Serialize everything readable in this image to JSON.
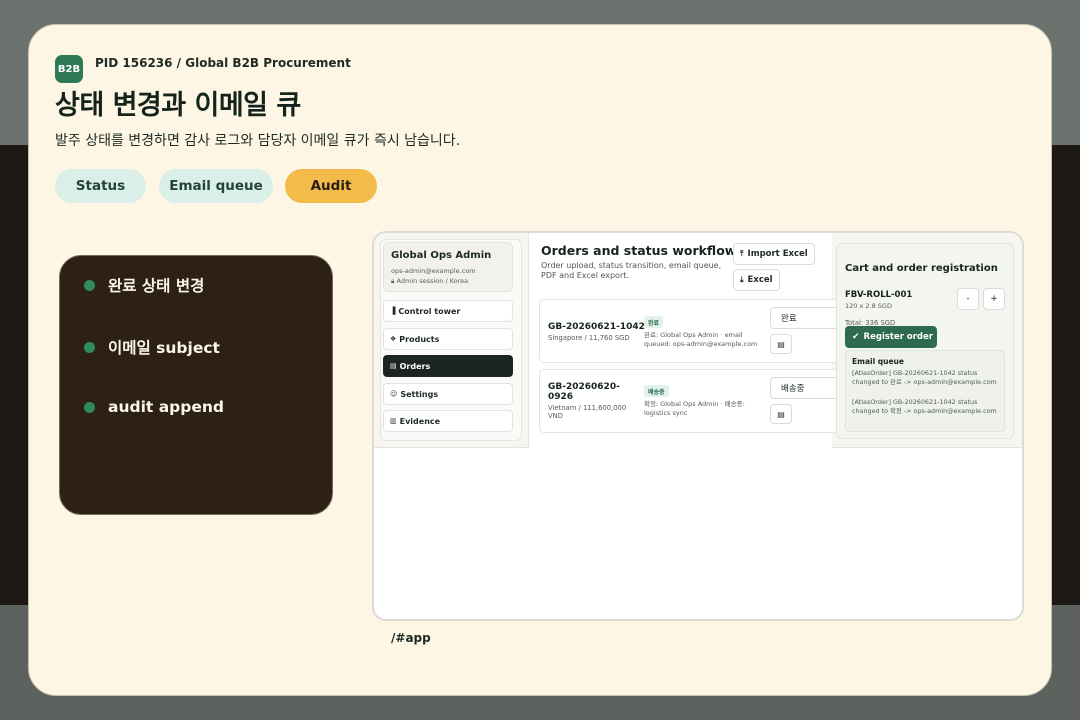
{
  "header": {
    "badge": "B2B",
    "pid": "PID 156236 / Global B2B Procurement",
    "title": "상태 변경과 이메일 큐",
    "subtitle": "발주 상태를 변경하면 감사 로그와 담당자 이메일 큐가 즉시 남습니다."
  },
  "pills": {
    "status": "Status",
    "email_queue": "Email queue",
    "audit": "Audit"
  },
  "steps": [
    "완료 상태 변경",
    "이메일 subject",
    "audit append"
  ],
  "app": {
    "admin": {
      "name": "Global Ops Admin",
      "email": "ops-admin@example.com",
      "session": "Admin session / Korea"
    },
    "nav": [
      "Control tower",
      "Products",
      "Orders",
      "Settings",
      "Evidence"
    ],
    "main": {
      "title": "Orders and status workflow",
      "description": "Order upload, status transition, email queue, PDF and Excel export.",
      "import_label": "Import Excel",
      "excel_label": "Excel"
    },
    "orders": [
      {
        "id": "GB-20260621-1042",
        "meta": "Singapore / 11,760 SGD",
        "badge": "완료",
        "note": "완료: Global Ops Admin · email queued: ops-admin@example.com",
        "status": "완료"
      },
      {
        "id": "GB-20260620-0926",
        "meta": "Vietnam / 111,600,000 VND",
        "badge": "배송중",
        "note": "확정: Global Ops Admin · 배송중: logistics sync",
        "status": "배송중"
      }
    ],
    "cart": {
      "title": "Cart and order registration",
      "sku": "FBV-ROLL-001",
      "sku_meta": "120 x 2.8 SGD",
      "minus": "-",
      "plus": "+",
      "total": "Total: 336 SGD",
      "register_label": "Register order",
      "email_queue_title": "Email queue",
      "email_queue": [
        "[AtlasOrder] GB-20260621-1042 status changed to 완료 -> ops-admin@example.com",
        "[AtlasOrder] GB-20260621-1042 status changed to 확정 -> ops-admin@example.com"
      ]
    }
  },
  "footer": {
    "path": "/#app"
  },
  "colors": {
    "accent_green": "#2e7a57",
    "audit_yellow": "#f2bb4a",
    "pill_mint": "#d9efe7",
    "dark_panel": "#2d2116",
    "cream": "#fdf6e4"
  }
}
